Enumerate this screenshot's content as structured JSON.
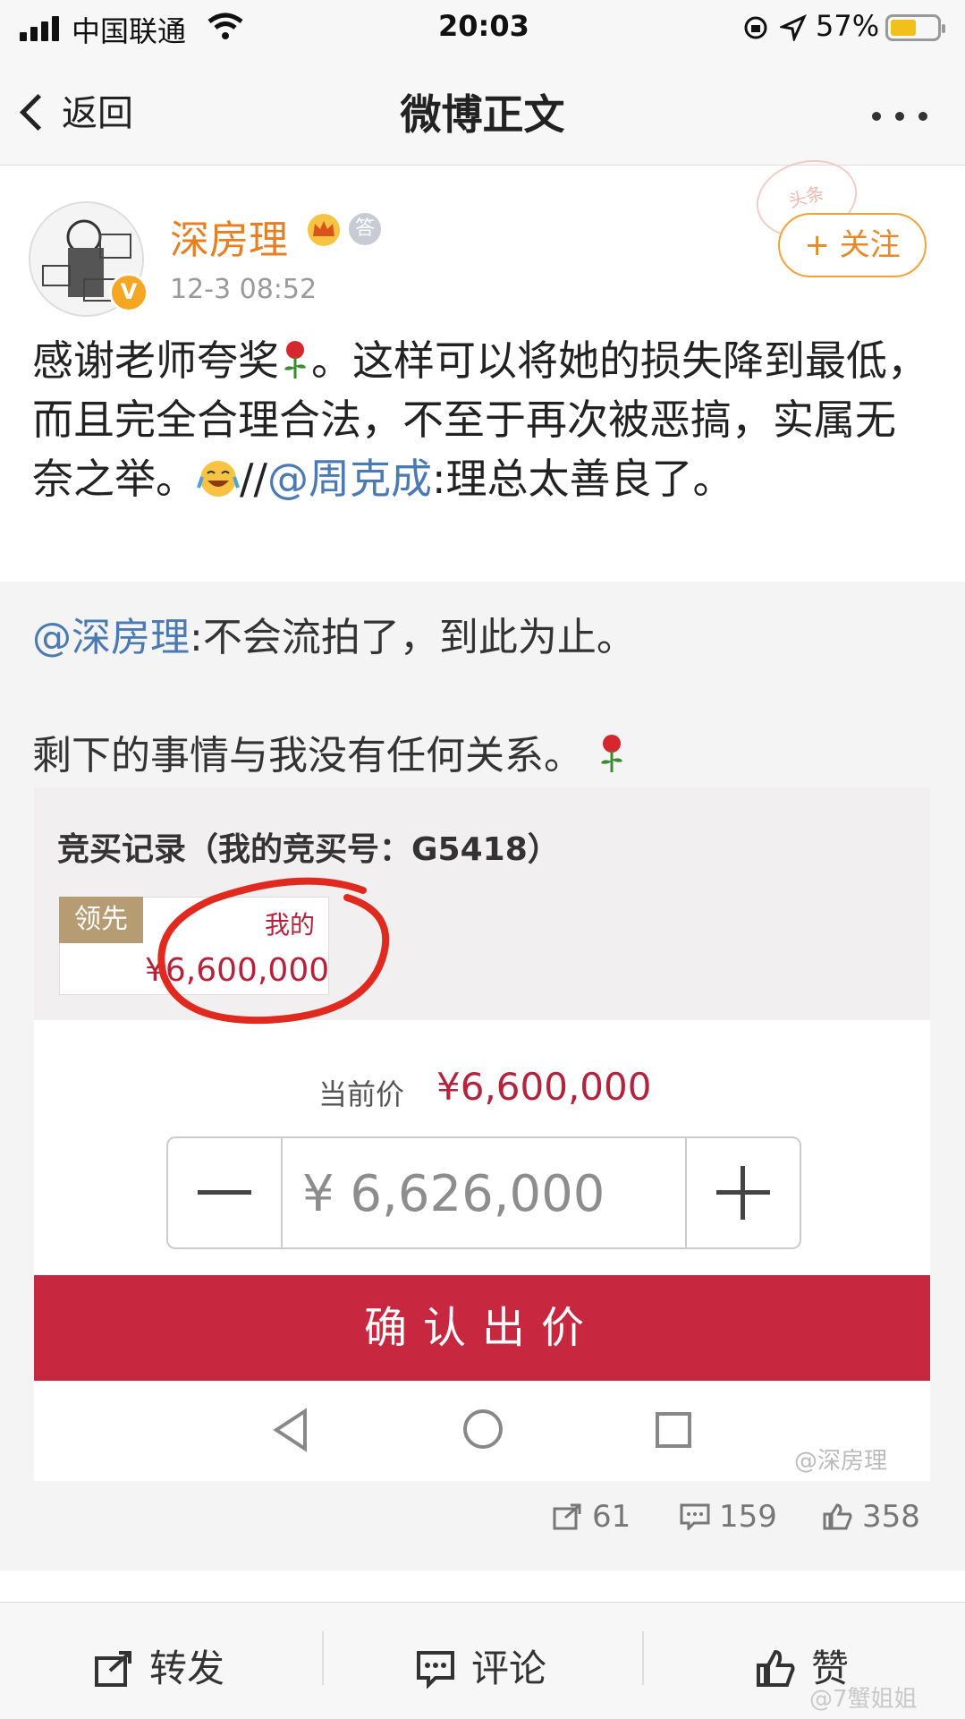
{
  "status": {
    "carrier": "中国联通",
    "time": "20:03",
    "battery": "57%",
    "battery_level": 0.57
  },
  "nav": {
    "back": "返回",
    "title": "微博正文"
  },
  "post": {
    "username": "深房理",
    "time": "12-3 08:52",
    "follow": "关注",
    "follow_plus": "+",
    "stamp": "头条",
    "text_1": "感谢老师夸奖",
    "text_2": "。这样可以将她的损失降到最低，而且完全合理合法，不至于再次被恶搞，实属无奈之举。",
    "text_3": "//",
    "mention_1": "@周克成",
    "text_4": ":理总太善良了。"
  },
  "repost": {
    "mention": "@深房理",
    "line_1": ":不会流拍了，到此为止。",
    "line_2": "剩下的事情与我没有任何关系。"
  },
  "screenshot": {
    "title": "竞买记录（我的竞买号：G5418）",
    "lead": "领先",
    "me": "我的",
    "bid_amount": "¥6,600,000",
    "current_label": "当前价",
    "current_value": "¥6,600,000",
    "input_value": "¥ 6,626,000",
    "confirm": "确认出价",
    "watermark": "@深房理"
  },
  "counts": {
    "reposts": "61",
    "comments": "159",
    "likes": "358"
  },
  "bottom": {
    "repost": "转发",
    "comment": "评论",
    "like": "赞",
    "watermark": "@7蟹姐姐"
  },
  "colors": {
    "accent": "#e67e22",
    "link": "#4b7ab3",
    "price_red": "#b3243c",
    "confirm_bg": "#c8283f"
  }
}
